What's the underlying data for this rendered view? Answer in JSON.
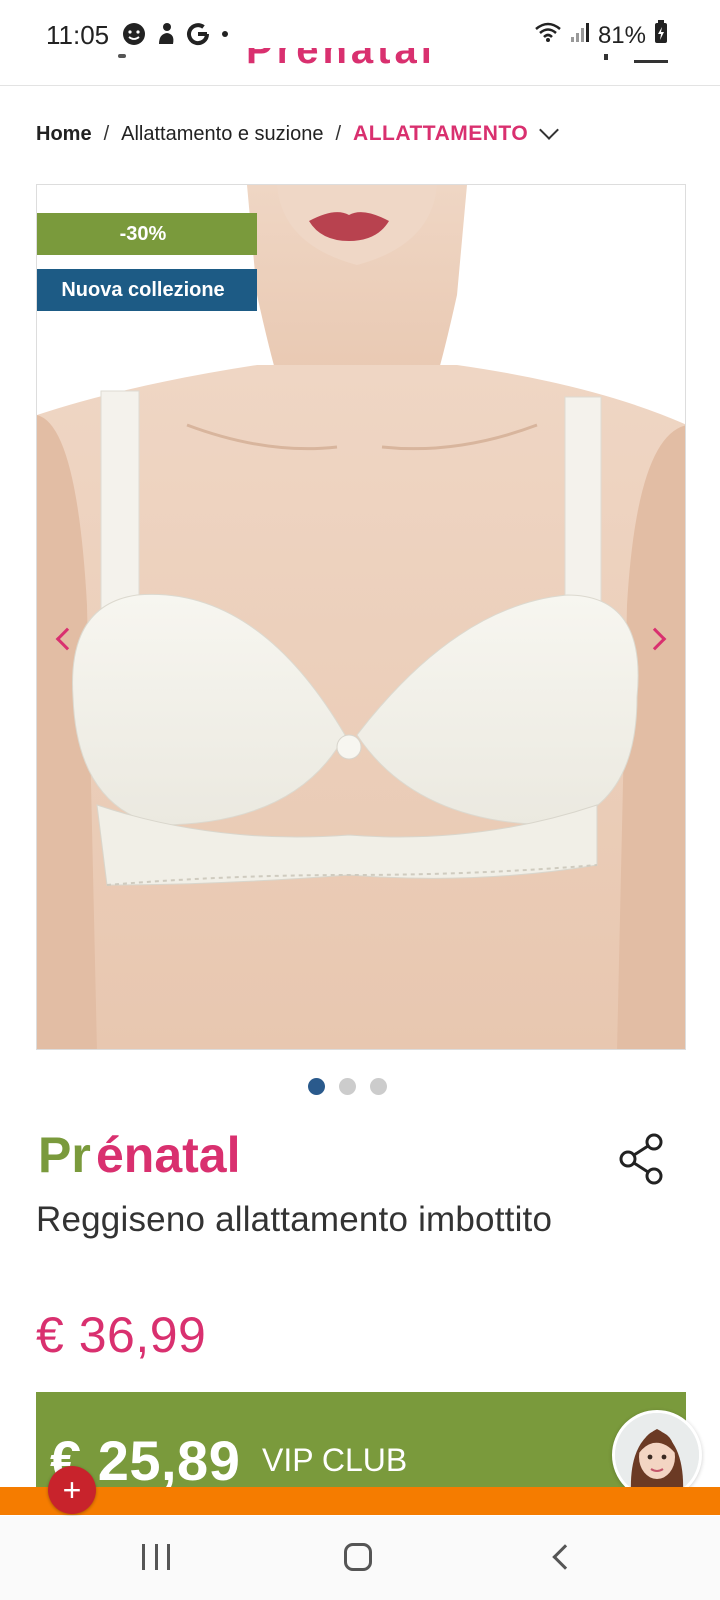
{
  "status_bar": {
    "time": "11:05",
    "battery": "81%"
  },
  "breadcrumb": {
    "home": "Home",
    "separator": "/",
    "middle": "Allattamento e suzione",
    "current": "ALLATTAMENTO"
  },
  "gallery": {
    "badges": {
      "discount": "-30%",
      "new": "Nuova collezione"
    },
    "slide_count": 3,
    "active_slide": 1
  },
  "product": {
    "brand": "Prénatal",
    "title": "Reggiseno allattamento imbottito",
    "old_price": "€ 36,99",
    "vip_price": "€ 25,89",
    "vip_label": "VIP CLUB"
  },
  "colors": {
    "brand_pink": "#d9306f",
    "brand_green": "#7a9a3c",
    "badge_blue": "#1d5b85",
    "active_dot": "#2a5a8c",
    "orange_bar": "#f57c00",
    "plus_button": "#c8232c"
  },
  "icons": {
    "share": "share-icon",
    "plus": "plus-icon",
    "menu": "hamburger-icon"
  }
}
